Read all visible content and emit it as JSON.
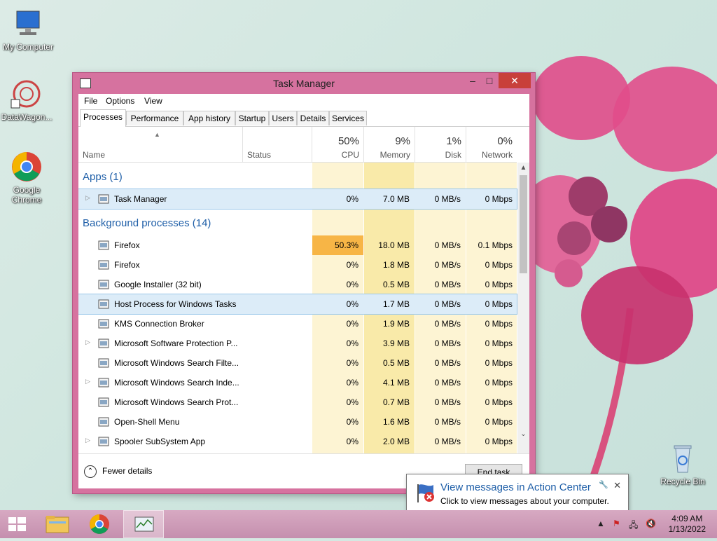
{
  "desktop": {
    "icons": [
      {
        "label": "My Computer"
      },
      {
        "label": "DataWagon..."
      },
      {
        "label": "Google Chrome"
      },
      {
        "label": "Recycle Bin"
      }
    ]
  },
  "window": {
    "title": "Task Manager",
    "menu": [
      "File",
      "Options",
      "View"
    ],
    "tabs": [
      "Processes",
      "Performance",
      "App history",
      "Startup",
      "Users",
      "Details",
      "Services"
    ],
    "active_tab": "Processes",
    "columns": {
      "name": "Name",
      "status": "Status",
      "cpu": {
        "pct": "50%",
        "label": "CPU"
      },
      "memory": {
        "pct": "9%",
        "label": "Memory"
      },
      "disk": {
        "pct": "1%",
        "label": "Disk"
      },
      "network": {
        "pct": "0%",
        "label": "Network"
      }
    },
    "groups": {
      "apps": "Apps (1)",
      "background": "Background processes (14)"
    },
    "app_rows": [
      {
        "name": "Task Manager",
        "cpu": "0%",
        "memory": "7.0 MB",
        "disk": "0 MB/s",
        "network": "0 Mbps",
        "expandable": true
      }
    ],
    "bg_rows": [
      {
        "name": "Firefox",
        "cpu": "50.3%",
        "memory": "18.0 MB",
        "disk": "0 MB/s",
        "network": "0.1 Mbps",
        "expandable": false
      },
      {
        "name": "Firefox",
        "cpu": "0%",
        "memory": "1.8 MB",
        "disk": "0 MB/s",
        "network": "0 Mbps",
        "expandable": false
      },
      {
        "name": "Google Installer (32 bit)",
        "cpu": "0%",
        "memory": "0.5 MB",
        "disk": "0 MB/s",
        "network": "0 Mbps",
        "expandable": false
      },
      {
        "name": "Host Process for Windows Tasks",
        "cpu": "0%",
        "memory": "1.7 MB",
        "disk": "0 MB/s",
        "network": "0 Mbps",
        "expandable": false
      },
      {
        "name": "KMS Connection Broker",
        "cpu": "0%",
        "memory": "1.9 MB",
        "disk": "0 MB/s",
        "network": "0 Mbps",
        "expandable": false
      },
      {
        "name": "Microsoft Software Protection P...",
        "cpu": "0%",
        "memory": "3.9 MB",
        "disk": "0 MB/s",
        "network": "0 Mbps",
        "expandable": true
      },
      {
        "name": "Microsoft Windows Search Filte...",
        "cpu": "0%",
        "memory": "0.5 MB",
        "disk": "0 MB/s",
        "network": "0 Mbps",
        "expandable": false
      },
      {
        "name": "Microsoft Windows Search Inde...",
        "cpu": "0%",
        "memory": "4.1 MB",
        "disk": "0 MB/s",
        "network": "0 Mbps",
        "expandable": true
      },
      {
        "name": "Microsoft Windows Search Prot...",
        "cpu": "0%",
        "memory": "0.7 MB",
        "disk": "0 MB/s",
        "network": "0 Mbps",
        "expandable": false
      },
      {
        "name": "Open-Shell Menu",
        "cpu": "0%",
        "memory": "1.6 MB",
        "disk": "0 MB/s",
        "network": "0 Mbps",
        "expandable": false
      },
      {
        "name": "Spooler SubSystem App",
        "cpu": "0%",
        "memory": "2.0 MB",
        "disk": "0 MB/s",
        "network": "0 Mbps",
        "expandable": true
      }
    ],
    "fewer_details": "Fewer details",
    "end_task": "End task"
  },
  "notification": {
    "title": "View messages in Action Center",
    "text": "Click to view messages about your computer."
  },
  "taskbar": {
    "time": "4:09 AM",
    "date": "1/13/2022"
  },
  "colors": {
    "window_frame": "#d6729f",
    "close_button": "#c8403a",
    "heat_light": "#fdf4d3",
    "heat_mid": "#f9eaa9",
    "heat_high": "#f7b546",
    "group_text": "#1f5fa8"
  }
}
